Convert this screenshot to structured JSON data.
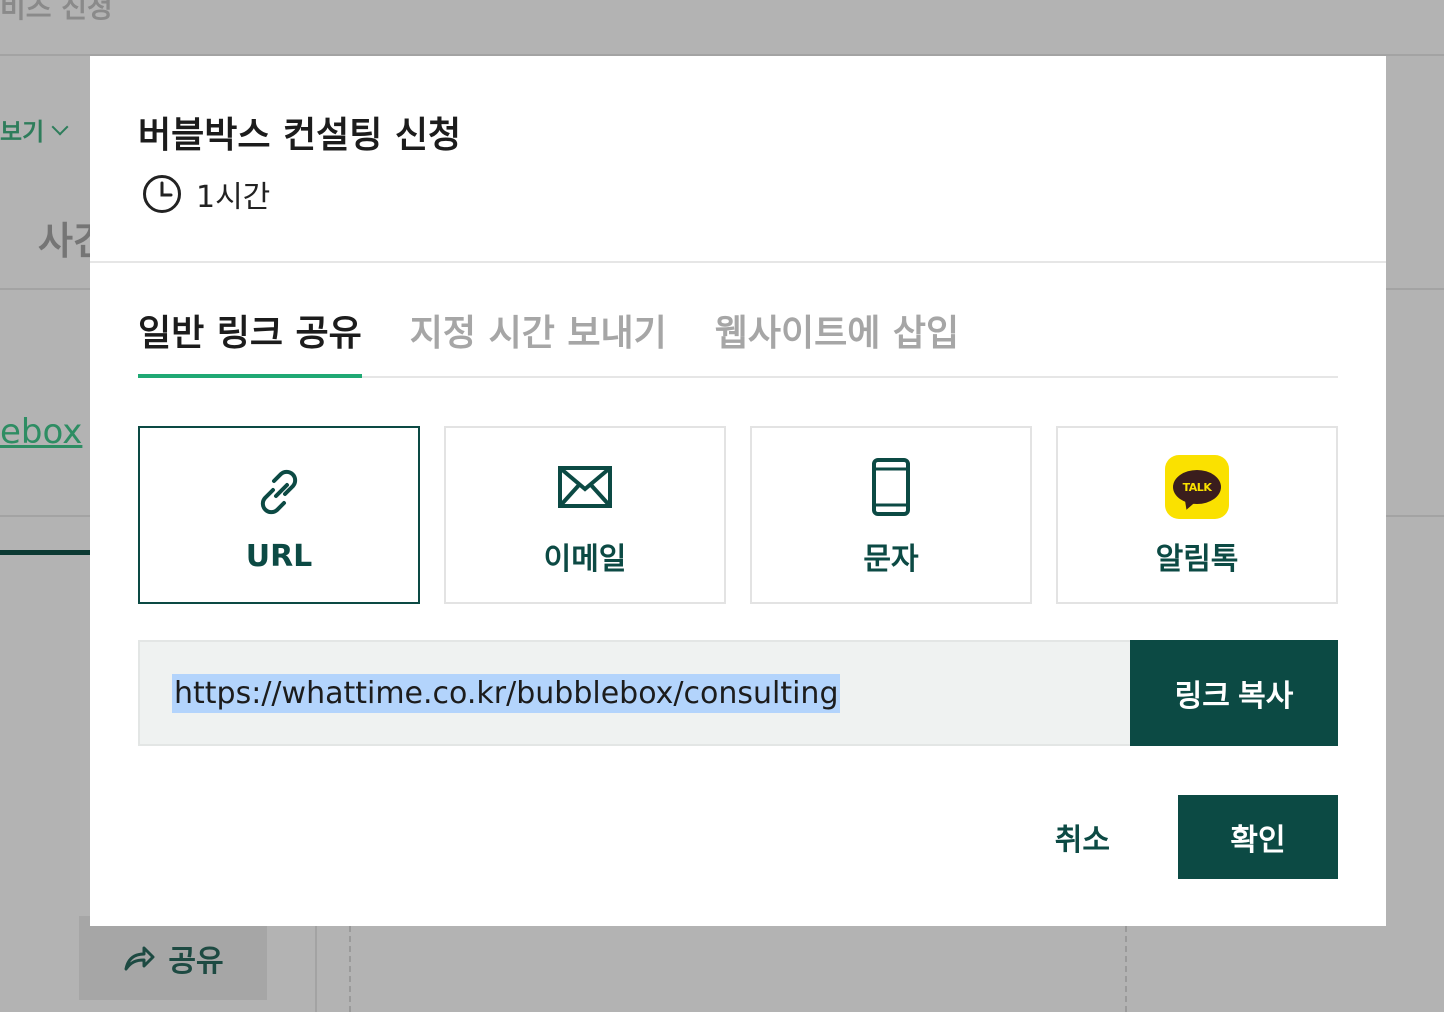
{
  "background": {
    "top_title": "비즈 신청",
    "view_label": "보기",
    "heading": "사건",
    "link_text": "ebox",
    "share_label": "공유"
  },
  "modal": {
    "title": "버블박스 컨설팅 신청",
    "duration": "1시간",
    "tabs": [
      {
        "label": "일반 링크 공유",
        "active": true
      },
      {
        "label": "지정 시간 보내기",
        "active": false
      },
      {
        "label": "웹사이트에 삽입",
        "active": false
      }
    ],
    "channels": [
      {
        "label": "URL",
        "icon": "link-icon",
        "selected": true
      },
      {
        "label": "이메일",
        "icon": "envelope-icon",
        "selected": false
      },
      {
        "label": "문자",
        "icon": "phone-icon",
        "selected": false
      },
      {
        "label": "알림톡",
        "icon": "kakaotalk-icon",
        "badge_text": "TALK",
        "selected": false
      }
    ],
    "url_value": "https://whattime.co.kr/bubblebox/consulting",
    "copy_button": "링크 복사",
    "cancel_button": "취소",
    "confirm_button": "확인"
  },
  "colors": {
    "primary": "#0c4a44",
    "tab_accent": "#1fa974",
    "kakao_yellow": "#fae100",
    "overlay": "#b3b3b3"
  }
}
